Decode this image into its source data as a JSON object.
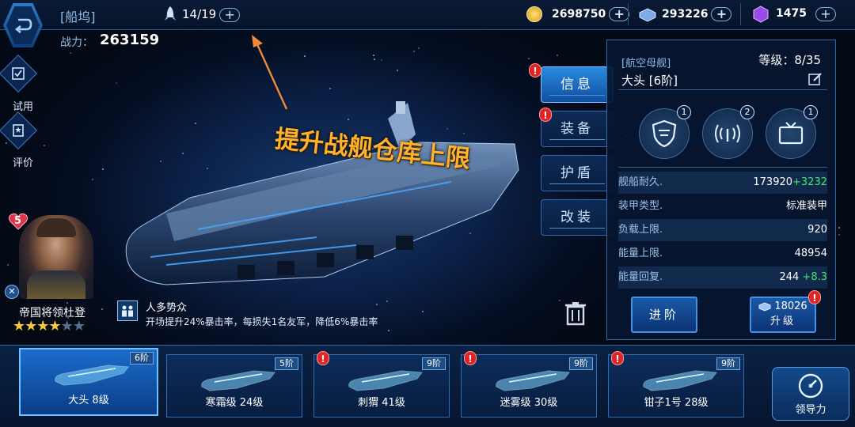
{
  "header": {
    "title": "[船坞]",
    "power_label": "战力：",
    "power_value": "263159"
  },
  "dock_capacity": "14/19",
  "resources": [
    {
      "icon": "gold-coin-icon",
      "value": "2698750",
      "color": "#f5c842"
    },
    {
      "icon": "crystal-icon",
      "value": "293226",
      "color": "#8fb4f0"
    },
    {
      "icon": "purple-gem-icon",
      "value": "1475",
      "color": "#a955f0"
    }
  ],
  "left_buttons": [
    {
      "label": "试用"
    },
    {
      "label": "评价"
    }
  ],
  "commander": {
    "level": "5",
    "name": "帝国将领杜登",
    "stars_filled": 4,
    "stars_total": 6
  },
  "skill": {
    "name": "人多势众",
    "desc": "开场提升24%暴击率，每损失1名友军，降低6%暴击率"
  },
  "annotation": "提升战舰仓库上限",
  "tabs": [
    {
      "label": "信息",
      "active": true,
      "alert": true
    },
    {
      "label": "装备",
      "active": false,
      "alert": true
    },
    {
      "label": "护盾",
      "active": false,
      "alert": false
    },
    {
      "label": "改装",
      "active": false,
      "alert": false
    }
  ],
  "panel": {
    "type": "[航空母舰]",
    "level_label": "等级：8/35",
    "ship_name": "大头 [6阶]",
    "skills": [
      {
        "icon": "armor-shield-icon",
        "count": "1"
      },
      {
        "icon": "signal-icon",
        "count": "2"
      },
      {
        "icon": "tv-icon",
        "count": "1"
      }
    ],
    "stats": [
      {
        "label": "舰船耐久.",
        "value": "173920",
        "bonus": "+3232"
      },
      {
        "label": "装甲类型.",
        "value": "标准装甲",
        "bonus": ""
      },
      {
        "label": "负载上限.",
        "value": "920",
        "bonus": ""
      },
      {
        "label": "能量上限.",
        "value": "48954",
        "bonus": ""
      },
      {
        "label": "能量回复.",
        "value": "244",
        "bonus": "+8.3"
      }
    ],
    "advance_label": "进阶",
    "upgrade_cost": "18026",
    "upgrade_label": "升级"
  },
  "ships": [
    {
      "name": "大头 8级",
      "tier": "6阶",
      "alert": false,
      "selected": true
    },
    {
      "name": "寒霜级 24级",
      "tier": "5阶",
      "alert": false,
      "selected": false
    },
    {
      "name": "刺猬 41级",
      "tier": "9阶",
      "alert": true,
      "selected": false
    },
    {
      "name": "迷雾级 30级",
      "tier": "9阶",
      "alert": true,
      "selected": false
    },
    {
      "name": "钳子1号 28级",
      "tier": "9阶",
      "alert": true,
      "selected": false
    }
  ],
  "leadership_label": "领导力",
  "alert_glyph": "!"
}
